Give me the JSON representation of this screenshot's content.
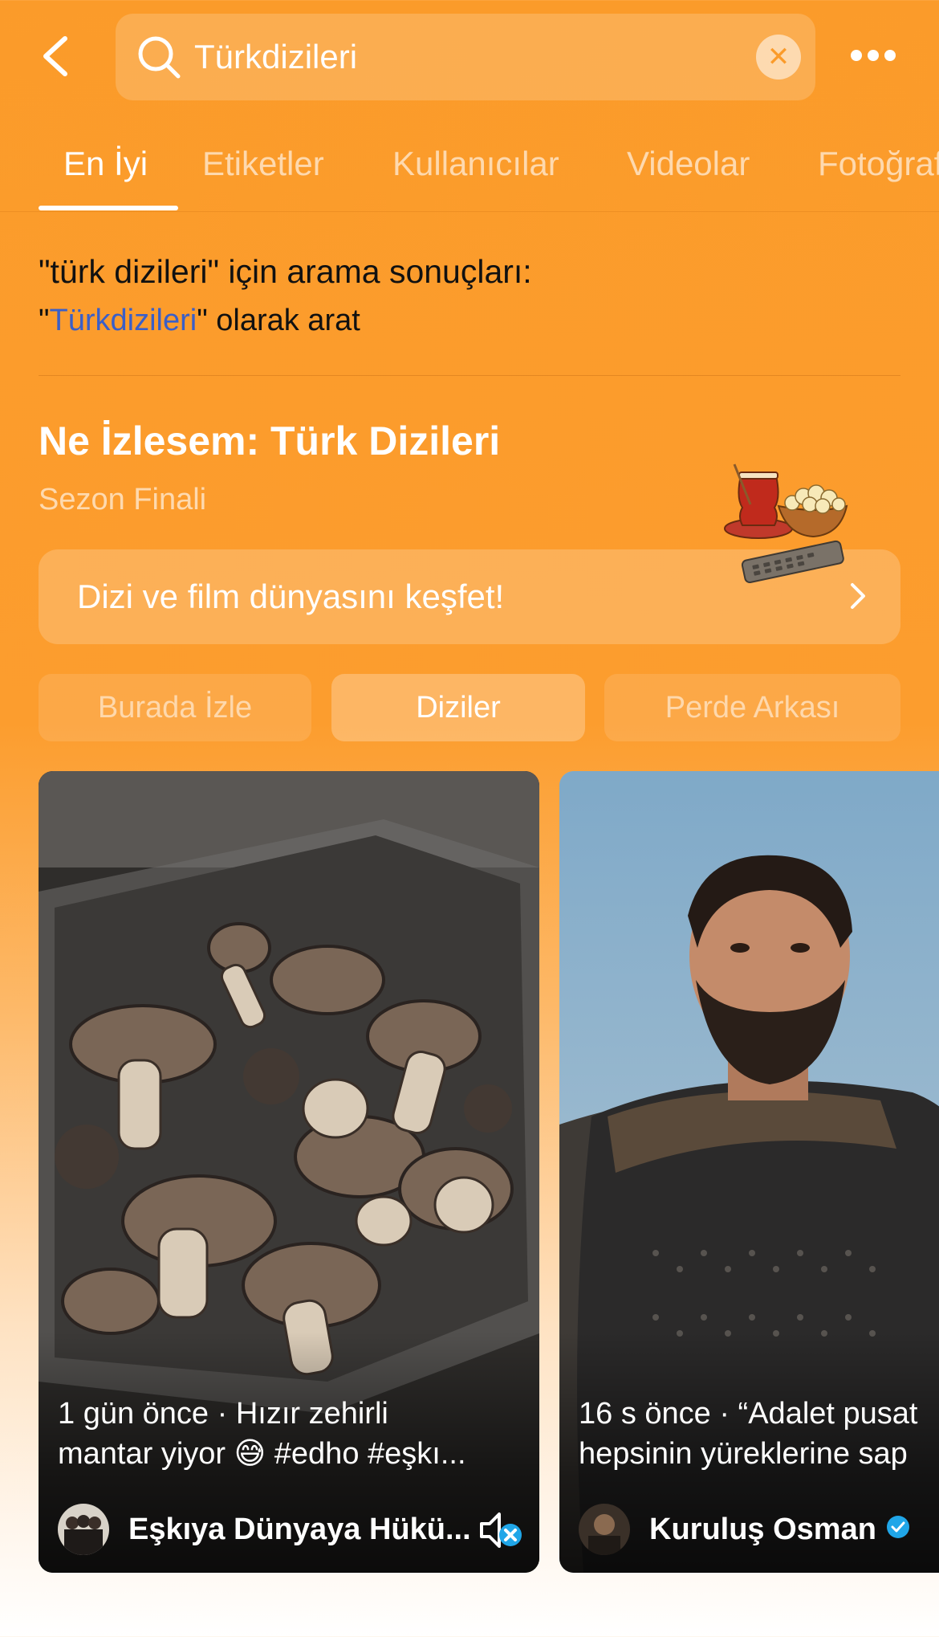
{
  "search": {
    "query": "Türkdizileri",
    "clear_icon": "✕"
  },
  "tabs": [
    {
      "label": "En İyi",
      "active": true
    },
    {
      "label": "Etiketler",
      "active": false
    },
    {
      "label": "Kullanıcılar",
      "active": false
    },
    {
      "label": "Videolar",
      "active": false
    },
    {
      "label": "Fotoğraflar",
      "active": false
    }
  ],
  "results": {
    "line": "\"türk dizileri\" için arama sonuçları:",
    "alt_prefix": "\"",
    "alt_query": "Türkdizileri",
    "alt_suffix": "\" olarak arat"
  },
  "collection": {
    "title": "Ne İzlesem: Türk Dizileri",
    "subtitle": "Sezon Finali",
    "explore_label": "Dizi ve film dünyasını keşfet!"
  },
  "filters": [
    {
      "label": "Burada İzle",
      "active": false
    },
    {
      "label": "Diziler",
      "active": true
    },
    {
      "label": "Perde Arkası",
      "active": false
    }
  ],
  "videos": [
    {
      "caption_line1": "1 gün önce · Hızır zehirli",
      "caption_line2": "mantar yiyor 😅 #edho #eşkı...",
      "author": "Eşkıya Dünyaya Hükü...",
      "muted": true
    },
    {
      "caption_line1": "16 s önce · “Adalet pusat",
      "caption_line2": "hepsinin yüreklerine sap",
      "author": "Kuruluş Osman",
      "verified": true
    }
  ],
  "colors": {
    "background": "#fb9b2a",
    "link": "#3a5fc8",
    "verified": "#20a6e8"
  }
}
